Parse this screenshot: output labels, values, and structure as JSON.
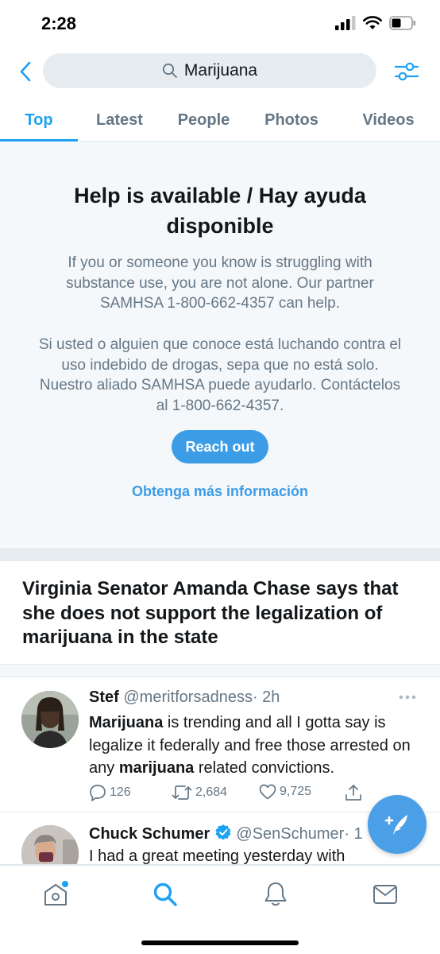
{
  "status_bar": {
    "time": "2:28"
  },
  "search": {
    "query": "Marijuana"
  },
  "tabs": [
    {
      "label": "Top",
      "active": true
    },
    {
      "label": "Latest",
      "active": false
    },
    {
      "label": "People",
      "active": false
    },
    {
      "label": "Photos",
      "active": false
    },
    {
      "label": "Videos",
      "active": false
    }
  ],
  "help": {
    "title": "Help is available / Hay ayuda disponible",
    "body_en": "If you or someone you know is struggling with substance use, you are not alone. Our partner SAMHSA 1-800-662-4357 can help.",
    "body_es": "Si usted o alguien que conoce está luchando contra el uso indebido de drogas, sepa que no está solo. Nuestro aliado SAMHSA puede ayudarlo. Contáctelos al 1-800-662-4357.",
    "button_label": "Reach out",
    "link_label": "Obtenga más información"
  },
  "headline": {
    "text": "Virginia Senator Amanda Chase says that she does not support the legalization of marijuana in the state"
  },
  "tweets": [
    {
      "name": "Stef",
      "handle": "@meritforsadness",
      "time": "· 2h",
      "text_parts": [
        "Marijuana",
        " is trending and all I gotta say is legalize it federally and free those arrested on any ",
        "marijuana",
        " related convictions."
      ],
      "replies": "126",
      "retweets": "2,684",
      "likes": "9,725"
    },
    {
      "name": "Chuck Schumer",
      "handle": "@SenSchumer",
      "time": "· 1",
      "text": "I had a great meeting yesterday with"
    }
  ],
  "colors": {
    "accent": "#1da1f2",
    "button": "#3c9ce6",
    "secondary_text": "#657786",
    "card_bg": "#f5f8fa"
  },
  "icons": {
    "back": "chevron-left-icon",
    "search": "search-icon",
    "filter": "sliders-icon",
    "more": "more-icon",
    "reply": "reply-icon",
    "retweet": "retweet-icon",
    "like": "heart-icon",
    "share": "share-icon",
    "compose": "compose-tweet-icon",
    "home": "home-icon",
    "explore": "search-icon",
    "notifications": "bell-icon",
    "messages": "mail-icon"
  }
}
